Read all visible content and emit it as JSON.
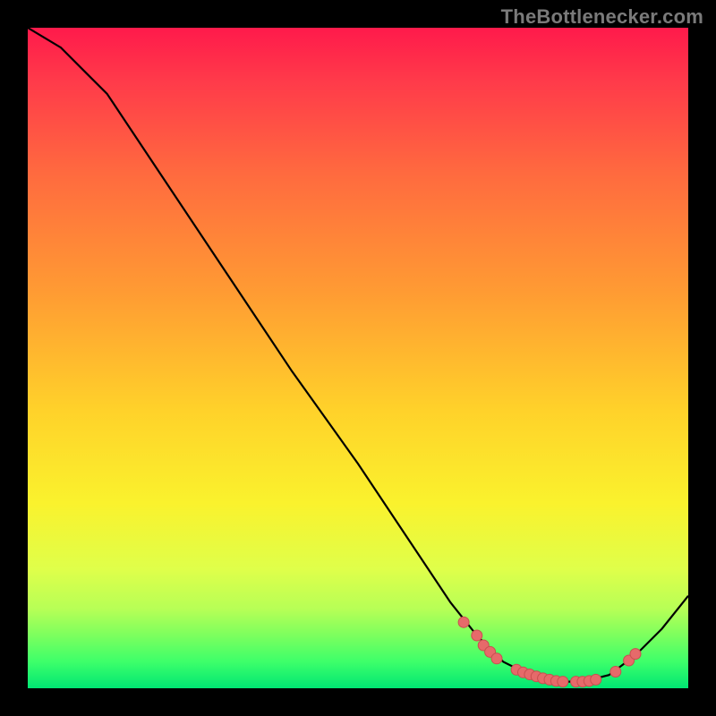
{
  "watermark": "TheBottlenecker.com",
  "colors": {
    "background": "#000000",
    "gradient_top": "#ff1a4b",
    "gradient_bottom": "#00e673",
    "curve_stroke": "#000000",
    "marker_fill": "#e66a6a",
    "marker_stroke": "#c94f4f"
  },
  "chart_data": {
    "type": "line",
    "title": "",
    "xlabel": "",
    "ylabel": "",
    "xlim": [
      0,
      100
    ],
    "ylim": [
      0,
      100
    ],
    "curve": [
      {
        "x": 0,
        "y": 100
      },
      {
        "x": 5,
        "y": 97
      },
      {
        "x": 9,
        "y": 93
      },
      {
        "x": 12,
        "y": 90
      },
      {
        "x": 20,
        "y": 78
      },
      {
        "x": 30,
        "y": 63
      },
      {
        "x": 40,
        "y": 48
      },
      {
        "x": 50,
        "y": 34
      },
      {
        "x": 58,
        "y": 22
      },
      {
        "x": 64,
        "y": 13
      },
      {
        "x": 68,
        "y": 8
      },
      {
        "x": 72,
        "y": 4
      },
      {
        "x": 76,
        "y": 2
      },
      {
        "x": 80,
        "y": 1
      },
      {
        "x": 84,
        "y": 1
      },
      {
        "x": 88,
        "y": 2
      },
      {
        "x": 92,
        "y": 5
      },
      {
        "x": 96,
        "y": 9
      },
      {
        "x": 100,
        "y": 14
      }
    ],
    "markers": [
      {
        "x": 66,
        "y": 10
      },
      {
        "x": 68,
        "y": 8
      },
      {
        "x": 69,
        "y": 6.5
      },
      {
        "x": 70,
        "y": 5.5
      },
      {
        "x": 71,
        "y": 4.5
      },
      {
        "x": 74,
        "y": 2.8
      },
      {
        "x": 75,
        "y": 2.4
      },
      {
        "x": 76,
        "y": 2.1
      },
      {
        "x": 77,
        "y": 1.8
      },
      {
        "x": 78,
        "y": 1.5
      },
      {
        "x": 79,
        "y": 1.3
      },
      {
        "x": 80,
        "y": 1.1
      },
      {
        "x": 81,
        "y": 1.0
      },
      {
        "x": 83,
        "y": 1.0
      },
      {
        "x": 84,
        "y": 1.0
      },
      {
        "x": 85,
        "y": 1.1
      },
      {
        "x": 86,
        "y": 1.3
      },
      {
        "x": 89,
        "y": 2.5
      },
      {
        "x": 91,
        "y": 4.2
      },
      {
        "x": 92,
        "y": 5.2
      }
    ]
  }
}
